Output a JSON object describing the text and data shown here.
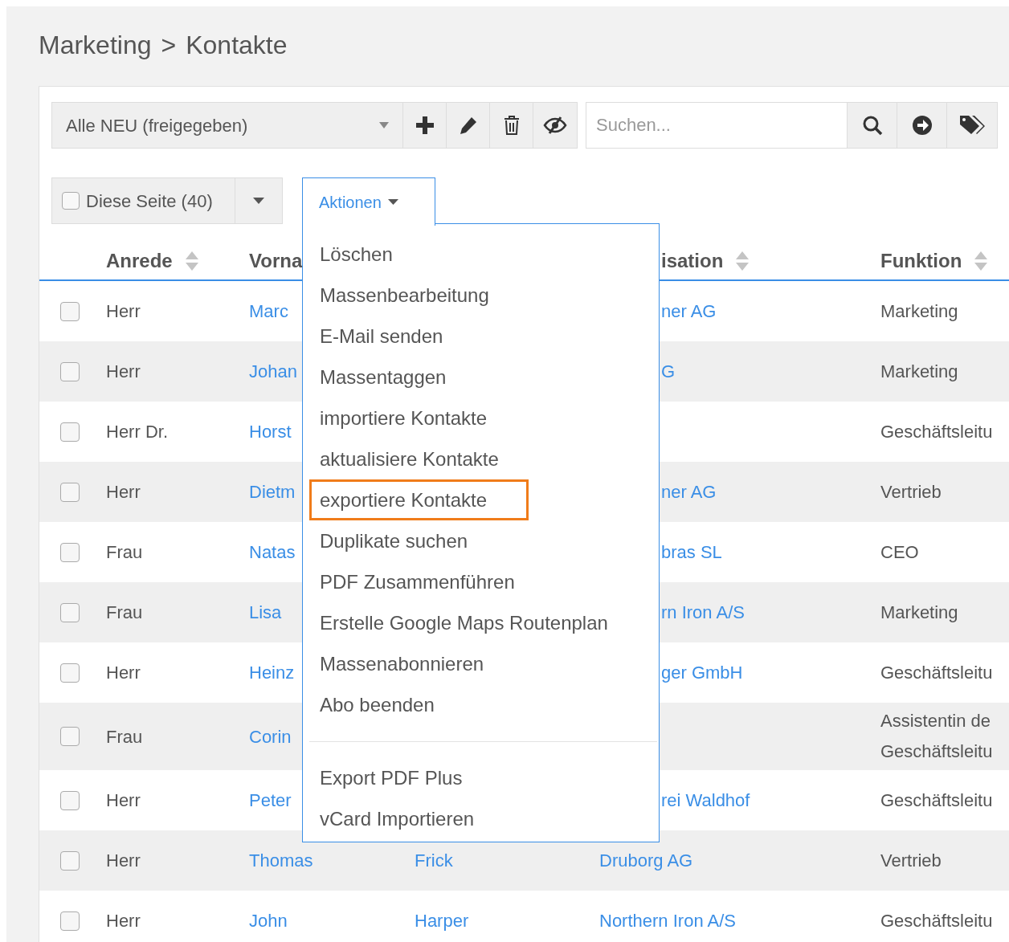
{
  "breadcrumb": {
    "parent": "Marketing",
    "separator": ">",
    "current": "Kontakte"
  },
  "toolbar": {
    "view_select": "Alle NEU (freigegeben)",
    "search": {
      "placeholder": "Suchen..."
    }
  },
  "selection": {
    "label": "Diese Seite (40)",
    "checked": false
  },
  "actions_button": {
    "label": "Aktionen",
    "expanded": true
  },
  "actions_menu": [
    {
      "label": "Löschen",
      "highlighted": false
    },
    {
      "label": "Massenbearbeitung",
      "highlighted": false
    },
    {
      "label": "E-Mail senden",
      "highlighted": false
    },
    {
      "label": "Massentaggen",
      "highlighted": false
    },
    {
      "label": "importiere Kontakte",
      "highlighted": false
    },
    {
      "label": "aktualisiere Kontakte",
      "highlighted": false
    },
    {
      "label": "exportiere Kontakte",
      "highlighted": true
    },
    {
      "label": "Duplikate suchen",
      "highlighted": false
    },
    {
      "label": "PDF Zusammenführen",
      "highlighted": false
    },
    {
      "label": "Erstelle Google Maps Routenplan",
      "highlighted": false
    },
    {
      "label": "Massenabonnieren",
      "highlighted": false
    },
    {
      "label": "Abo beenden",
      "highlighted": false
    },
    {
      "kind": "divider"
    },
    {
      "label": "Export PDF Plus",
      "highlighted": false
    },
    {
      "label": "vCard Importieren",
      "highlighted": false
    }
  ],
  "table": {
    "columns": [
      {
        "label": "Anrede"
      },
      {
        "label": "Vorna"
      },
      {
        "label": "isation"
      },
      {
        "label": "Funktion"
      }
    ],
    "rows": [
      {
        "kind": "covered",
        "checked": false,
        "anrede": "Herr",
        "vorname": "Marc",
        "organisation": "ner AG",
        "funktion": "Marketing"
      },
      {
        "kind": "covered",
        "checked": false,
        "anrede": "Herr",
        "vorname": "Johan",
        "organisation": "G",
        "funktion": "Marketing"
      },
      {
        "kind": "covered",
        "checked": false,
        "anrede": "Herr Dr.",
        "vorname": "Horst",
        "funktion": "Geschäftsleitu"
      },
      {
        "kind": "covered",
        "checked": false,
        "anrede": "Herr",
        "vorname": "Dietm",
        "organisation": "ner AG",
        "funktion": "Vertrieb"
      },
      {
        "kind": "covered",
        "checked": false,
        "anrede": "Frau",
        "vorname": "Natas",
        "organisation": "bras SL",
        "funktion": "CEO"
      },
      {
        "kind": "covered",
        "checked": false,
        "anrede": "Frau",
        "vorname": "Lisa",
        "organisation": "rn Iron A/S",
        "funktion": "Marketing"
      },
      {
        "kind": "covered",
        "checked": false,
        "anrede": "Herr",
        "vorname": "Heinz",
        "organisation": "ger GmbH",
        "funktion": "Geschäftsleitu"
      },
      {
        "kind": "covered",
        "checked": false,
        "anrede": "Frau",
        "vorname": "Corin",
        "funktion": "Assistentin de Geschäftsleitu"
      },
      {
        "kind": "covered",
        "checked": false,
        "anrede": "Herr",
        "vorname": "Peter",
        "organisation": "rei Waldhof",
        "funktion": "Geschäftsleitu"
      },
      {
        "kind": "full",
        "checked": false,
        "anrede": "Herr",
        "vorname": "Thomas",
        "nachname": "Frick",
        "organisation": "Druborg AG",
        "funktion": "Vertrieb"
      },
      {
        "kind": "full",
        "checked": false,
        "anrede": "Herr",
        "vorname": "John",
        "nachname": "Harper",
        "organisation": "Northern Iron A/S",
        "funktion": "Geschäftsleitu"
      }
    ]
  }
}
